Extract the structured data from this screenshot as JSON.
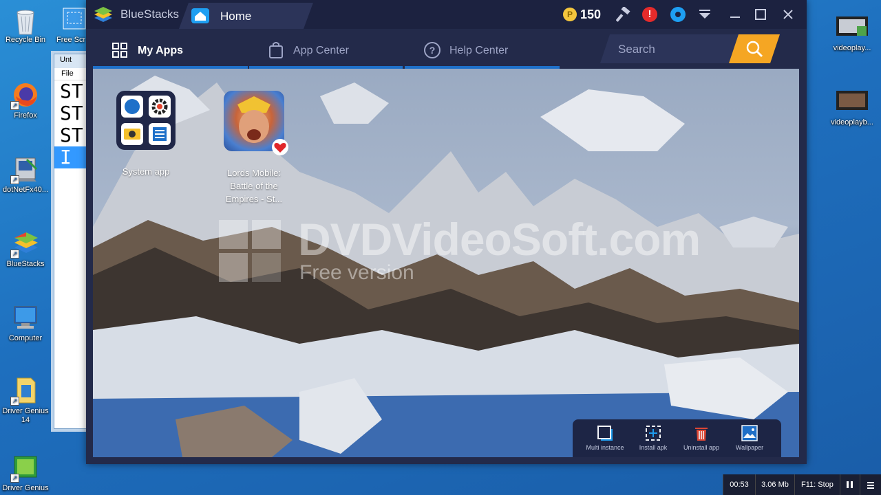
{
  "desktop": {
    "left_icons": [
      {
        "label": "Recycle Bin"
      },
      {
        "label": "Firefox"
      },
      {
        "label": "dotNetFx40..."
      },
      {
        "label": "BlueStacks"
      },
      {
        "label": "Computer"
      },
      {
        "label": "Driver Genius 14"
      },
      {
        "label": "Driver Genius"
      }
    ],
    "free_scr_label": "Free Scr",
    "right_icons": [
      {
        "label": "videoplay..."
      },
      {
        "label": "videoplayb..."
      }
    ]
  },
  "notepad": {
    "title": "Unt",
    "menu": "File",
    "lines": [
      "ST",
      "ST",
      "ST",
      "I"
    ]
  },
  "bluestacks": {
    "app_name": "BlueStacks",
    "tab_home": "Home",
    "coin_symbol": "P",
    "coins": "150",
    "alert_symbol": "!",
    "nav": {
      "my_apps": "My Apps",
      "app_center": "App Center",
      "help_center": "Help Center",
      "help_symbol": "?"
    },
    "search": {
      "placeholder": "Search"
    },
    "apps": [
      {
        "label": "System app"
      },
      {
        "label": "Lords Mobile: Battle of the Empires - St..."
      }
    ],
    "watermark": {
      "title": "DVDVideoSoft.com",
      "subtitle": "Free version"
    },
    "toolbar": {
      "multi_instance": "Multi instance",
      "install_apk": "Install apk",
      "uninstall_app": "Uninstall app",
      "wallpaper": "Wallpaper"
    },
    "colors": {
      "accent": "#1e70c9",
      "search_button": "#f5a623",
      "window_bg": "#232a4a"
    }
  },
  "recorder_status": {
    "time": "00:53",
    "size": "3.06 Mb",
    "stop_hint": "F11: Stop"
  }
}
